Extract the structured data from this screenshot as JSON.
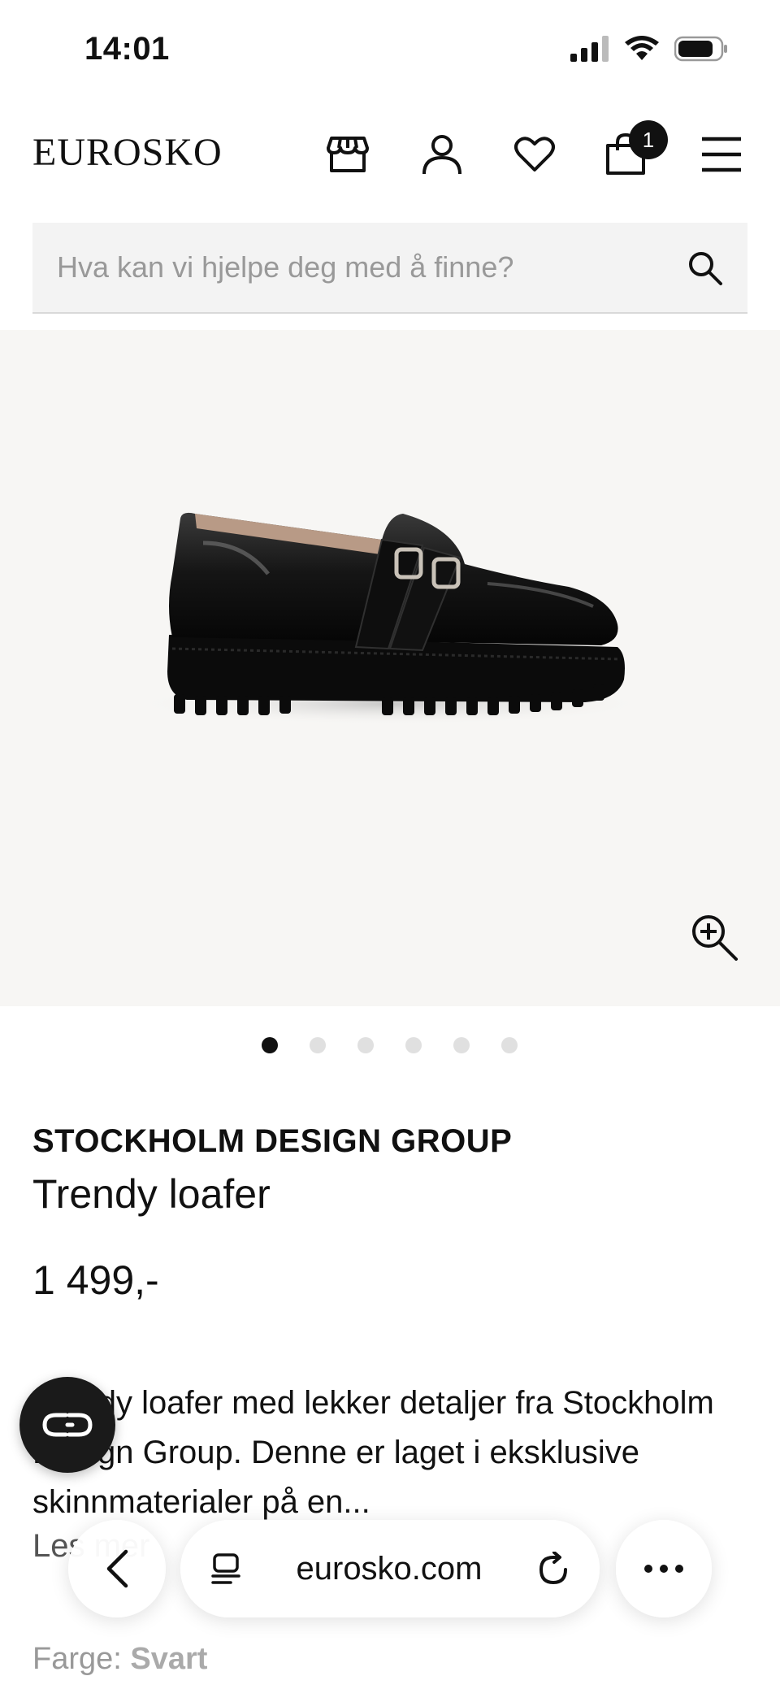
{
  "status_bar": {
    "time": "14:01"
  },
  "header": {
    "logo": "EUROSKO",
    "cart_count": "1"
  },
  "search": {
    "placeholder": "Hva kan vi hjelpe deg med å finne?"
  },
  "product": {
    "brand": "STOCKHOLM DESIGN GROUP",
    "name": "Trendy loafer",
    "price": "1 499,-",
    "description": "Trendy loafer med lekker detaljer fra Stockholm Design Group. Denne er laget i eksklusive skinnmaterialer på en...",
    "read_more": "Les mer",
    "color_label": "Farge:",
    "color_value": "Svart"
  },
  "carousel": {
    "total": 6,
    "active": 0
  },
  "browser": {
    "url": "eurosko.com"
  },
  "colors": {
    "accent": "#111111",
    "image_bg": "#f7f6f4",
    "search_bg": "#f3f3f3"
  }
}
